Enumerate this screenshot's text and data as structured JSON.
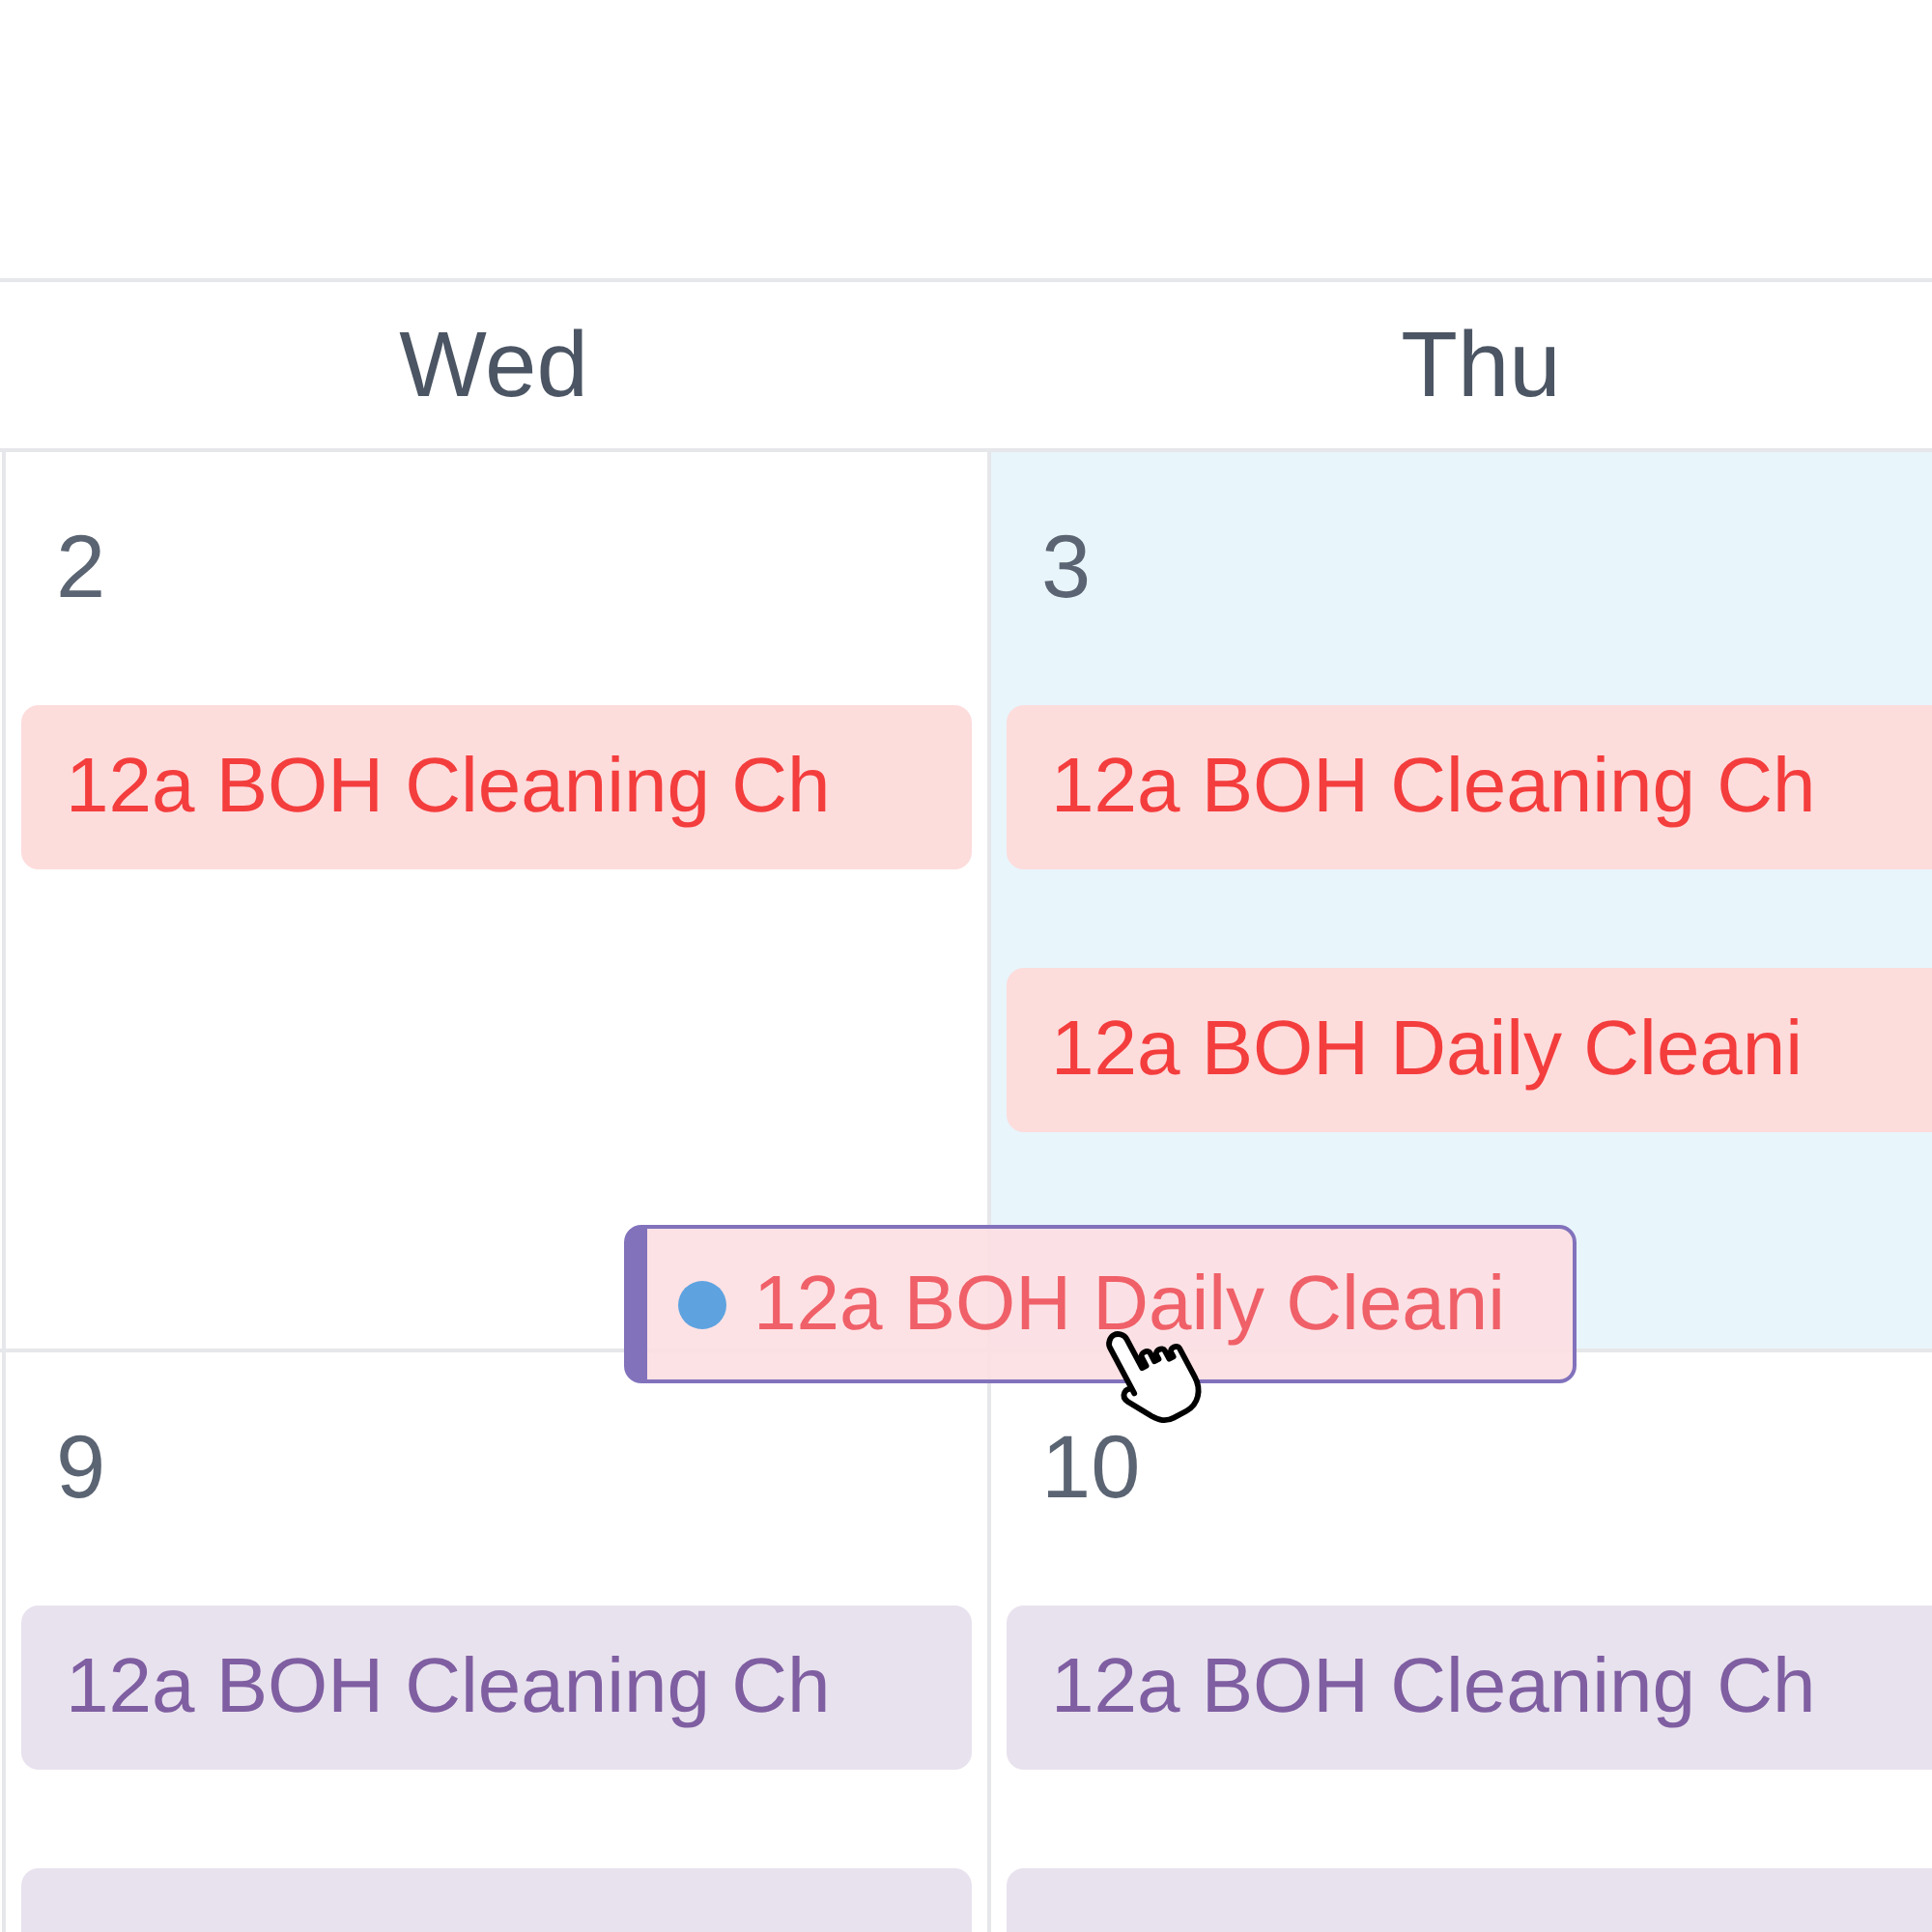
{
  "calendar": {
    "weekdays": [
      {
        "label": "Wed"
      },
      {
        "label": "Thu"
      }
    ],
    "weeks": [
      {
        "days": [
          {
            "number": "2",
            "today": false,
            "events": [
              {
                "title": "12a BOH Cleaning Ch",
                "color": "#fddcdc"
              }
            ]
          },
          {
            "number": "3",
            "today": true,
            "events": [
              {
                "title": "12a BOH Cleaning Ch",
                "color": "#fddcdc"
              },
              {
                "title": "12a BOH Daily Cleani",
                "color": "#fddcdc"
              }
            ]
          }
        ]
      },
      {
        "days": [
          {
            "number": "9",
            "today": false,
            "events": [
              {
                "title": "12a BOH Cleaning Ch",
                "color": "#e8e2ee"
              },
              {
                "color": "#e8e2ee"
              }
            ]
          },
          {
            "number": "10",
            "today": false,
            "events": [
              {
                "title": "12a BOH Cleaning Ch",
                "color": "#e8e2ee"
              },
              {
                "color": "#e8e2ee"
              }
            ]
          }
        ]
      }
    ]
  },
  "drag_preview": {
    "title": "12a BOH Daily Cleani",
    "color": "#5ea3e0"
  }
}
